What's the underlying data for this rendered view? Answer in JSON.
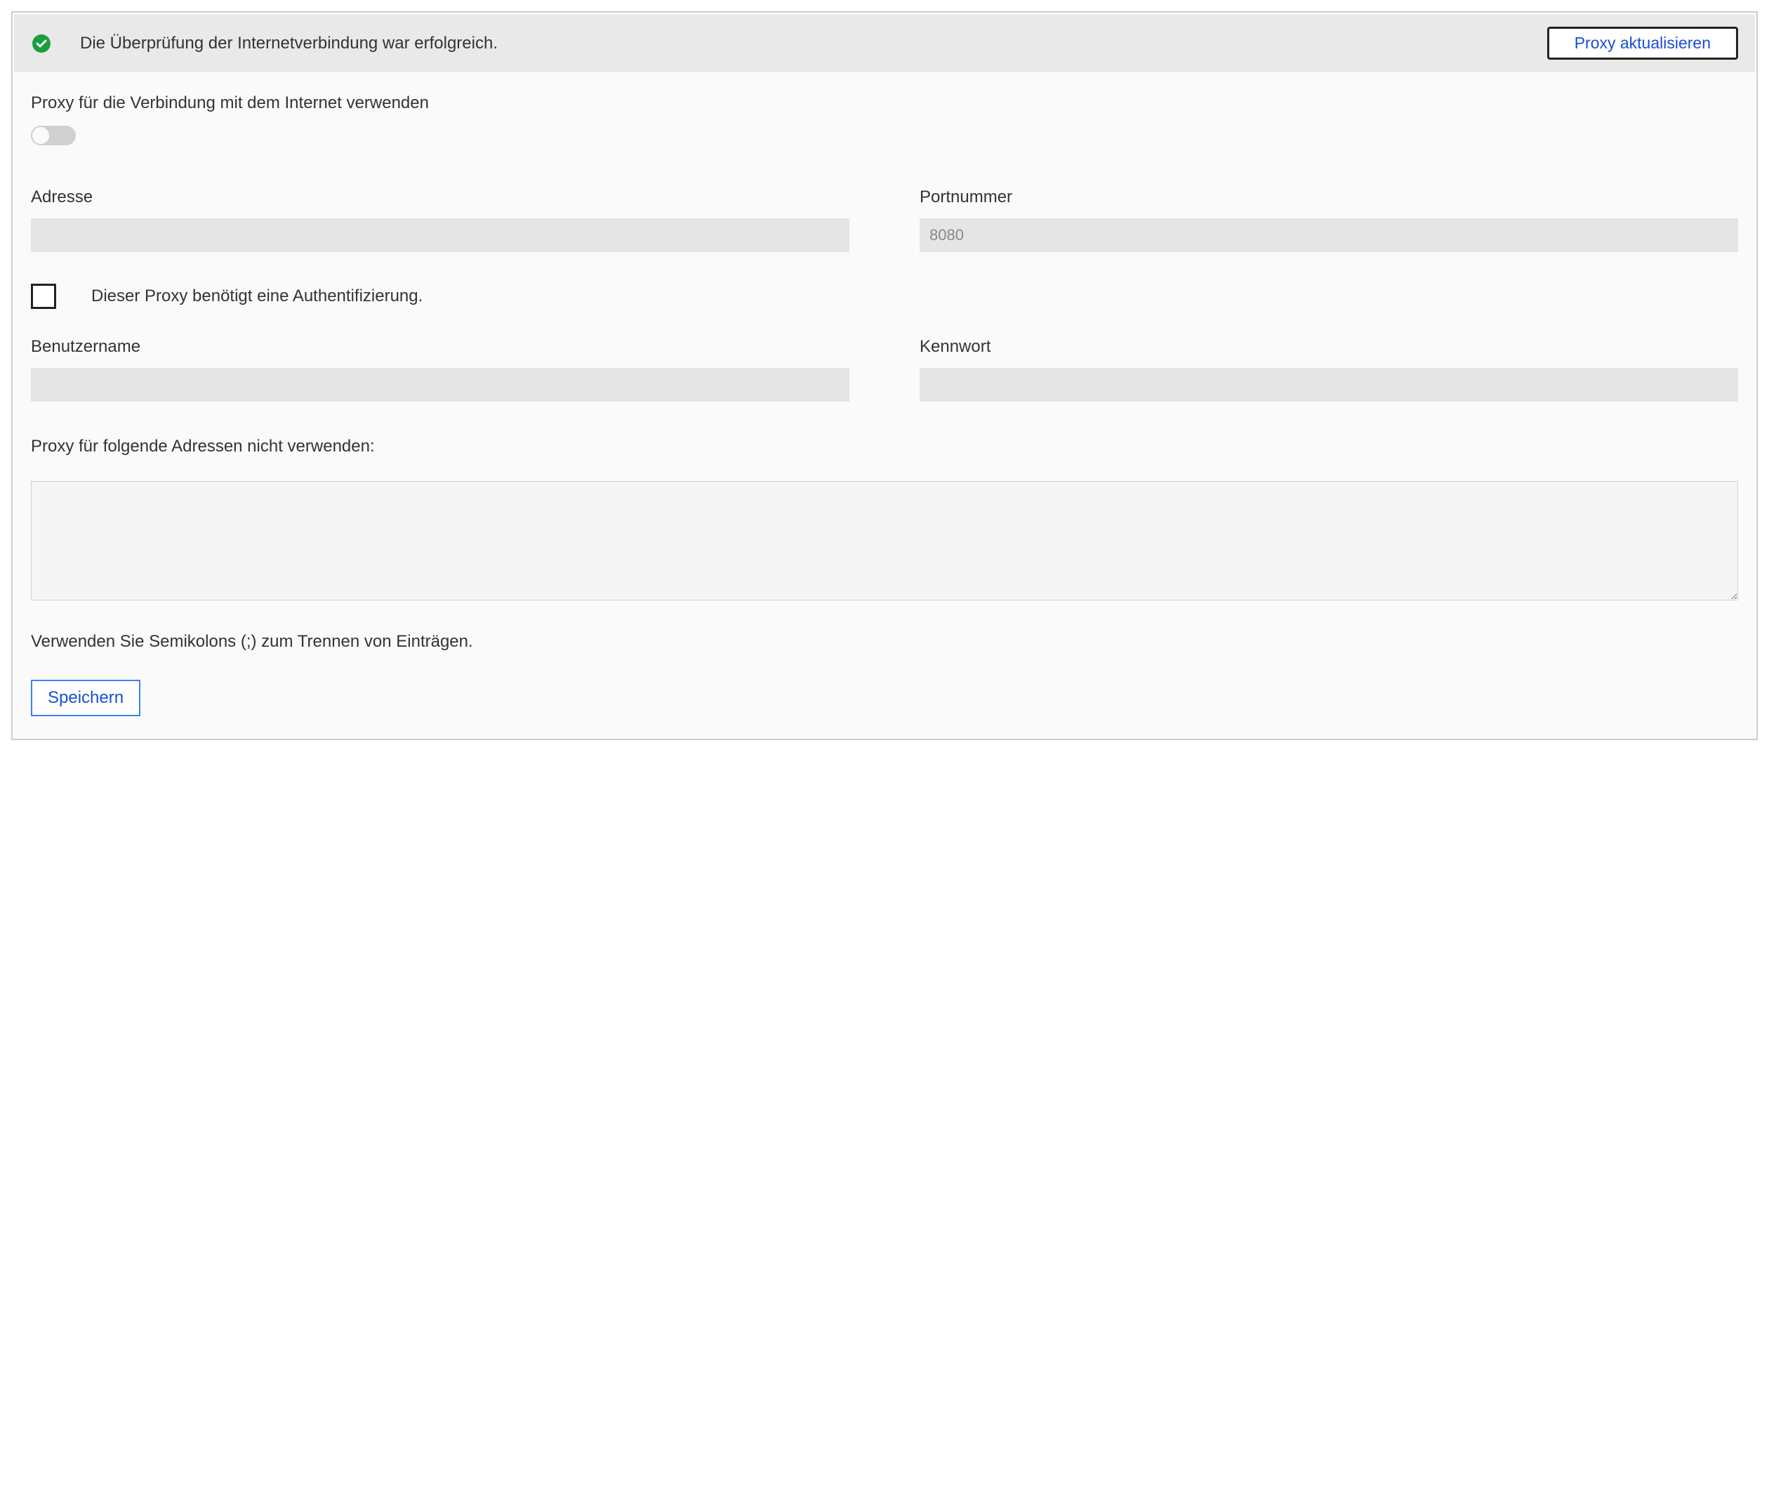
{
  "status": {
    "message": "Die Überprüfung der Internetverbindung war erfolgreich.",
    "refresh_label": "Proxy aktualisieren"
  },
  "proxy": {
    "toggle_label": "Proxy für die Verbindung mit dem Internet verwenden",
    "address_label": "Adresse",
    "address_value": "",
    "port_label": "Portnummer",
    "port_placeholder": "8080",
    "port_value": "",
    "auth_checkbox_label": "Dieser Proxy benötigt eine Authentifizierung.",
    "username_label": "Benutzername",
    "username_value": "",
    "password_label": "Kennwort",
    "password_value": "",
    "exclude_label": "Proxy für folgende Adressen nicht verwenden:",
    "exclude_value": "",
    "hint": "Verwenden Sie Semikolons (;) zum Trennen von Einträgen.",
    "save_label": "Speichern"
  }
}
